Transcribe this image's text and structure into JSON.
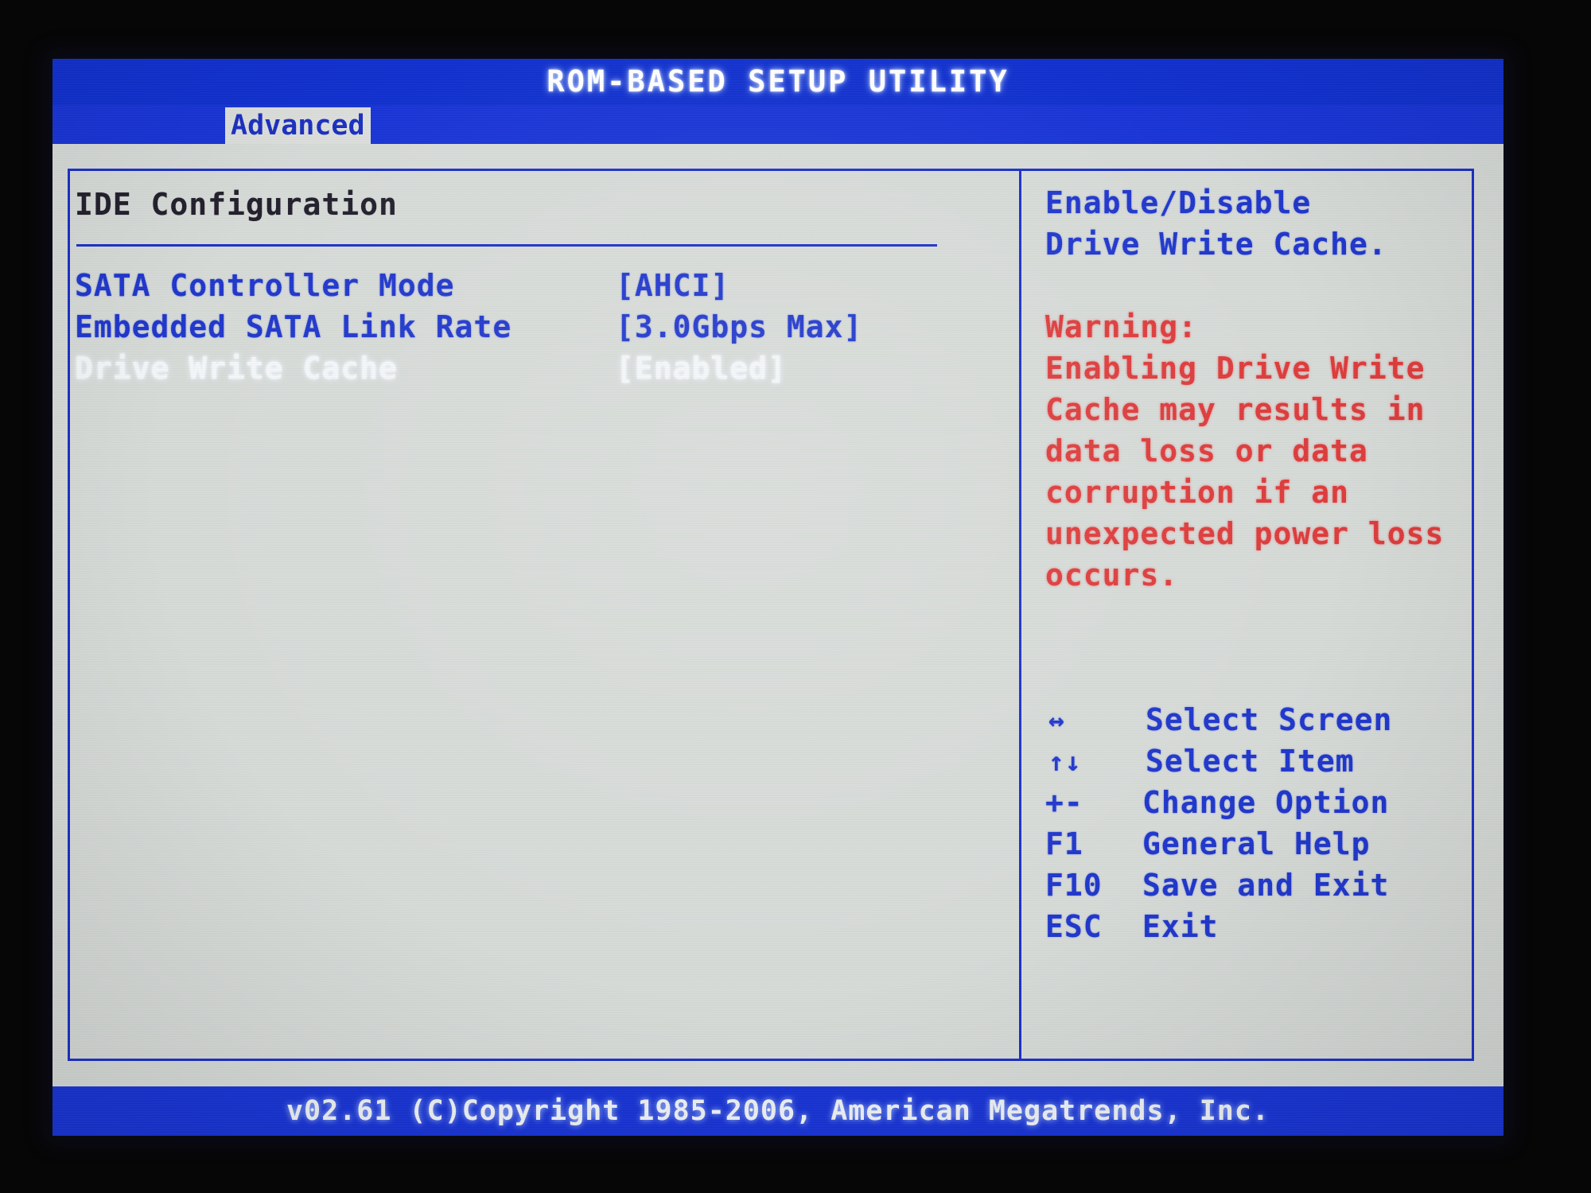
{
  "window": {
    "title": "ROM-BASED SETUP UTILITY"
  },
  "tabs": [
    {
      "label": "Advanced",
      "active": true
    }
  ],
  "main": {
    "section_title": "IDE Configuration",
    "settings": [
      {
        "label": "SATA Controller Mode",
        "value": "[AHCI]",
        "selected": false
      },
      {
        "label": "Embedded SATA Link Rate",
        "value": "[3.0Gbps Max]",
        "selected": false
      },
      {
        "label": "Drive Write Cache",
        "value": "[Enabled]",
        "selected": true
      }
    ]
  },
  "help": {
    "description_lines": [
      "Enable/Disable",
      "Drive Write Cache."
    ],
    "warning_lines": [
      "Warning:",
      "Enabling Drive Write",
      "Cache may results in",
      "data loss or data",
      "corruption if an",
      "unexpected power loss",
      "occurs."
    ]
  },
  "legend": [
    {
      "key": "↔",
      "desc": "Select Screen",
      "icon": "left-right-arrow-icon"
    },
    {
      "key": "↑↓",
      "desc": "Select Item",
      "icon": "up-down-arrow-icon"
    },
    {
      "key": "+-",
      "desc": "Change Option",
      "icon": "plus-minus-icon"
    },
    {
      "key": "F1",
      "desc": "General Help",
      "icon": ""
    },
    {
      "key": "F10",
      "desc": "Save and Exit",
      "icon": ""
    },
    {
      "key": "ESC",
      "desc": "Exit",
      "icon": ""
    }
  ],
  "footer": {
    "copyright": "v02.61 (C)Copyright 1985-2006, American Megatrends, Inc."
  },
  "colors": {
    "header_blue": "#1834d6",
    "screen_bg": "#d7dbd8",
    "text_blue": "#1f36cc",
    "warning_red": "#de3b3b",
    "selected_white": "#f4f6f8",
    "section_title": "#221f2c",
    "bezel_black": "#070607"
  }
}
